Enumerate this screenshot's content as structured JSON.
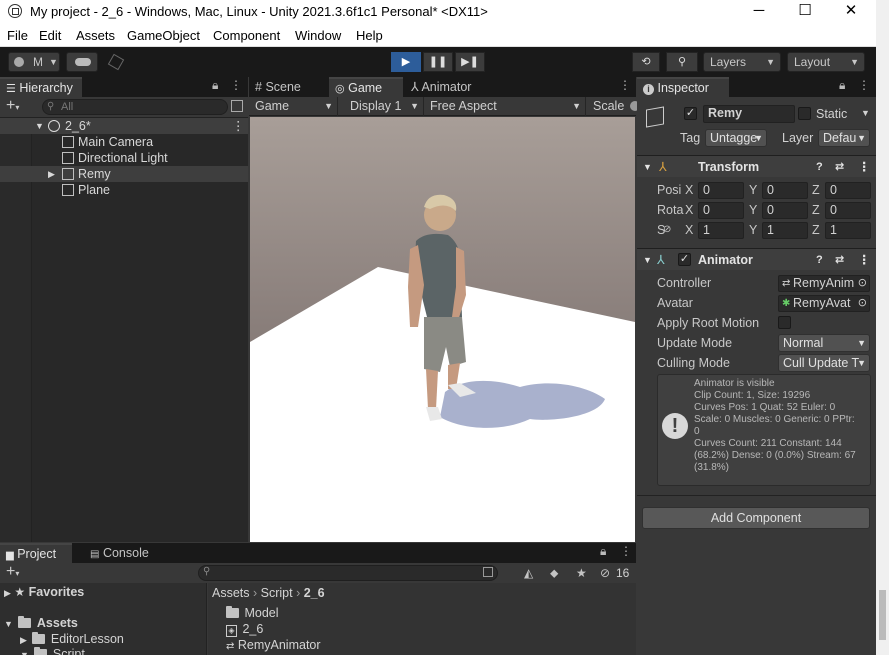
{
  "window": {
    "title": "My project - 2_6 - Windows, Mac, Linux - Unity 2021.3.6f1c1 Personal* <DX11>",
    "minimize": "─",
    "maximize": "☐",
    "close": "✕"
  },
  "menu": [
    "File",
    "Edit",
    "Assets",
    "GameObject",
    "Component",
    "Window",
    "Help"
  ],
  "toolbar": {
    "account": "M",
    "layers": "Layers",
    "layout": "Layout"
  },
  "hierarchy": {
    "tab": "Hierarchy",
    "search_placeholder": "All",
    "scene": "2_6*",
    "items": [
      "Main Camera",
      "Directional Light",
      "Remy",
      "Plane"
    ]
  },
  "game_view": {
    "tabs": [
      "Scene",
      "Game",
      "Animator"
    ],
    "mode": "Game",
    "display": "Display 1",
    "aspect": "Free Aspect",
    "scale": "Scale"
  },
  "inspector": {
    "tab": "Inspector",
    "object_name": "Remy",
    "static_label": "Static",
    "tag_label": "Tag",
    "tag_value": "Untagge",
    "layer_label": "Layer",
    "layer_value": "Defau",
    "transform": {
      "title": "Transform",
      "position_label": "Posi",
      "rotation_label": "Rota",
      "scale_label": "S",
      "position": [
        "0",
        "0",
        "0"
      ],
      "rotation": [
        "0",
        "0",
        "0"
      ],
      "scale": [
        "1",
        "1",
        "1"
      ],
      "axes": [
        "X",
        "Y",
        "Z"
      ]
    },
    "animator": {
      "title": "Animator",
      "controller_label": "Controller",
      "controller_value": "RemyAnim",
      "avatar_label": "Avatar",
      "avatar_value": "RemyAvat",
      "apply_root_motion_label": "Apply Root Motion",
      "update_mode_label": "Update Mode",
      "update_mode_value": "Normal",
      "culling_mode_label": "Culling Mode",
      "culling_mode_value": "Cull Update T",
      "info": "Animator is visible\nClip Count: 1, Size: 19296\nCurves Pos: 1 Quat: 52 Euler: 0\nScale: 0 Muscles: 0 Generic: 0 PPtr:\n0\nCurves Count: 211 Constant: 144\n(68.2%) Dense: 0 (0.0%) Stream: 67\n(31.8%)"
    },
    "add_component": "Add Component"
  },
  "project": {
    "tabs": [
      "Project",
      "Console"
    ],
    "hidden_count": "16",
    "favorites": "Favorites",
    "assets": "Assets",
    "tree": [
      "EditorLesson",
      "Script"
    ],
    "breadcrumb": [
      "Assets",
      "Script",
      "2_6"
    ],
    "files": [
      "Model",
      "2_6",
      "RemyAnimator"
    ]
  }
}
